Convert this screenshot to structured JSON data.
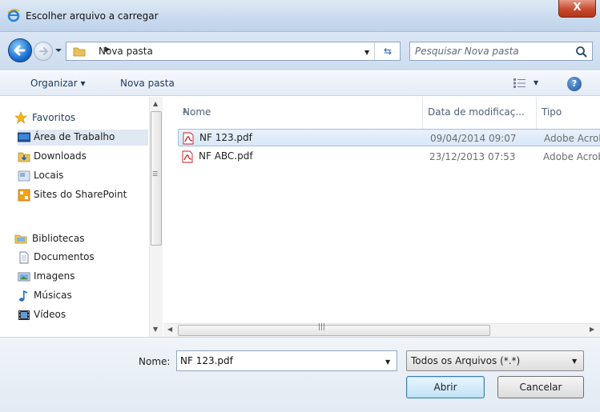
{
  "window": {
    "title": "Escolher arquivo a carregar",
    "close_label": "X"
  },
  "address_bar": {
    "path_label": "Nova pasta"
  },
  "search": {
    "placeholder": "Pesquisar Nova pasta"
  },
  "toolbar": {
    "organize_label": "Organizar ▾",
    "new_folder_label": "Nova pasta",
    "help_label": "?"
  },
  "nav_pane": {
    "favorites": {
      "label": "Favoritos",
      "items": [
        {
          "label": "Área de Trabalho",
          "icon": "desktop-icon",
          "selected": true
        },
        {
          "label": "Downloads",
          "icon": "downloads-folder-icon",
          "selected": false
        },
        {
          "label": "Locais",
          "icon": "recent-places-icon",
          "selected": false
        },
        {
          "label": "Sites do SharePoint",
          "icon": "sharepoint-icon",
          "selected": false
        }
      ]
    },
    "libraries": {
      "label": "Bibliotecas",
      "items": [
        {
          "label": "Documentos",
          "icon": "documents-icon"
        },
        {
          "label": "Imagens",
          "icon": "pictures-icon"
        },
        {
          "label": "Músicas",
          "icon": "music-icon"
        },
        {
          "label": "Vídeos",
          "icon": "videos-icon"
        }
      ]
    }
  },
  "file_list": {
    "columns": [
      "Nome",
      "Data de modificaç...",
      "Tipo"
    ],
    "rows": [
      {
        "name": "NF 123.pdf",
        "date": "09/04/2014 09:07",
        "type": "Adobe Acrobat Document",
        "selected": true
      },
      {
        "name": "NF ABC.pdf",
        "date": "23/12/2013 07:53",
        "type": "Adobe Acrobat Document",
        "selected": false
      }
    ]
  },
  "footer": {
    "name_label": "Nome:",
    "filename_value": "NF 123.pdf",
    "filter_value": "Todos os Arquivos (*.*)",
    "open_label": "Abrir",
    "cancel_label": "Cancelar"
  },
  "colors": {
    "accent": "#1b6fd1",
    "selection": "#d9e7f8",
    "close": "#c84a2e"
  }
}
